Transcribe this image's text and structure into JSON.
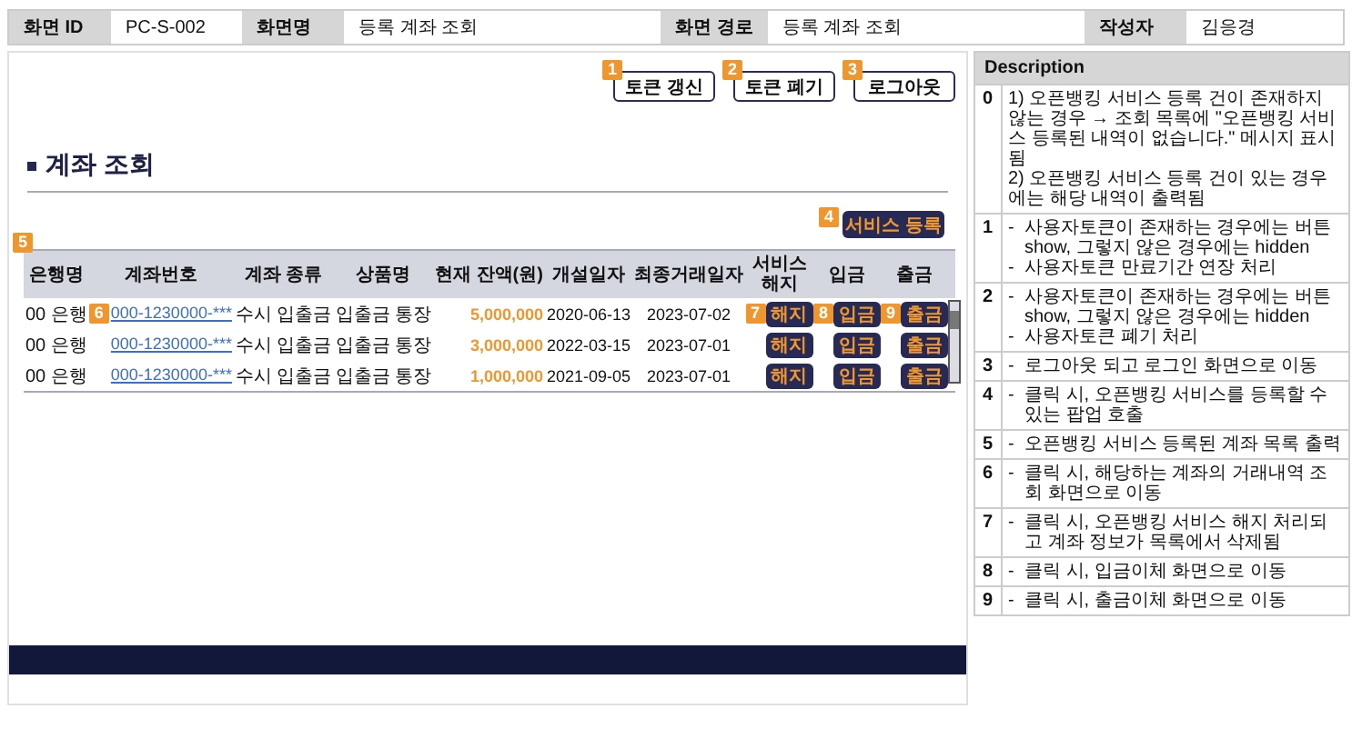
{
  "header": [
    {
      "label": "화면 ID",
      "value": "PC-S-002"
    },
    {
      "label": "화면명",
      "value": "등록 계좌 조회"
    },
    {
      "label": "화면 경로",
      "value": "등록 계좌 조회"
    },
    {
      "label": "작성자",
      "value": "김응경"
    }
  ],
  "toolbar": [
    {
      "badge": "1",
      "label": "토큰 갱신"
    },
    {
      "badge": "2",
      "label": "토큰 폐기"
    },
    {
      "badge": "3",
      "label": "로그아웃"
    }
  ],
  "section_title": "계좌 조회",
  "register_button": {
    "badge": "4",
    "label": "서비스 등록"
  },
  "table": {
    "badge": "5",
    "columns": [
      "은행명",
      "계좌번호",
      "계좌 종류",
      "상품명",
      "현재 잔액(원)",
      "개설일자",
      "최종거래일자",
      "서비스 해지",
      "입금",
      "출금"
    ],
    "rows": [
      {
        "bank": "00 은행",
        "account": "000-1230000-***",
        "account_badge": "6",
        "type": "수시 입출금",
        "product": "입출금 통장",
        "balance": "5,000,000",
        "opened": "2020-06-13",
        "last": "2023-07-02",
        "actions": [
          {
            "badge": "7",
            "label": "해지"
          },
          {
            "badge": "8",
            "label": "입금"
          },
          {
            "badge": "9",
            "label": "출금"
          }
        ]
      },
      {
        "bank": "00 은행",
        "account": "000-1230000-***",
        "type": "수시 입출금",
        "product": "입출금 통장",
        "balance": "3,000,000",
        "opened": "2022-03-15",
        "last": "2023-07-01",
        "actions": [
          {
            "label": "해지"
          },
          {
            "label": "입금"
          },
          {
            "label": "출금"
          }
        ]
      },
      {
        "bank": "00 은행",
        "account": "000-1230000-***",
        "type": "수시 입출금",
        "product": "입출금 통장",
        "balance": "1,000,000",
        "opened": "2021-09-05",
        "last": "2023-07-01",
        "actions": [
          {
            "label": "해지"
          },
          {
            "label": "입금"
          },
          {
            "label": "출금"
          }
        ]
      }
    ]
  },
  "description": {
    "title": "Description",
    "items": [
      {
        "no": "0",
        "lines": [
          {
            "text": "1) 오픈뱅킹 서비스 등록 건이 존재하지 않는 경우 → 조회 목록에 \"오픈뱅킹 서비스 등록된 내역이 없습니다.\" 메시지 표시됨"
          },
          {
            "text": "2) 오픈뱅킹 서비스 등록 건이 있는 경우에는 해당 내역이 출력됨"
          }
        ]
      },
      {
        "no": "1",
        "lines": [
          {
            "mark": "-",
            "text": "사용자토큰이 존재하는 경우에는 버튼 show, 그렇지 않은 경우에는 hidden"
          },
          {
            "mark": "-",
            "text": "사용자토큰 만료기간 연장 처리"
          }
        ]
      },
      {
        "no": "2",
        "lines": [
          {
            "mark": "-",
            "text": "사용자토큰이 존재하는 경우에는 버튼 show, 그렇지 않은 경우에는 hidden"
          },
          {
            "mark": "-",
            "text": "사용자토큰 폐기 처리"
          }
        ]
      },
      {
        "no": "3",
        "lines": [
          {
            "mark": "-",
            "text": "로그아웃 되고 로그인 화면으로 이동"
          }
        ]
      },
      {
        "no": "4",
        "lines": [
          {
            "mark": "-",
            "text": "클릭 시, 오픈뱅킹 서비스를 등록할 수 있는 팝업 호출"
          }
        ]
      },
      {
        "no": "5",
        "lines": [
          {
            "mark": "-",
            "text": "오픈뱅킹 서비스 등록된 계좌 목록 출력"
          }
        ]
      },
      {
        "no": "6",
        "lines": [
          {
            "mark": "-",
            "text": "클릭 시, 해당하는 계좌의 거래내역 조회 화면으로 이동"
          }
        ]
      },
      {
        "no": "7",
        "lines": [
          {
            "mark": "-",
            "text": "클릭 시, 오픈뱅킹 서비스 해지 처리되고 계좌 정보가 목록에서 삭제됨"
          }
        ]
      },
      {
        "no": "8",
        "lines": [
          {
            "mark": "-",
            "text": "클릭 시, 입금이체 화면으로 이동"
          }
        ]
      },
      {
        "no": "9",
        "lines": [
          {
            "mark": "-",
            "text": "클릭 시, 출금이체 화면으로 이동"
          }
        ]
      }
    ]
  }
}
